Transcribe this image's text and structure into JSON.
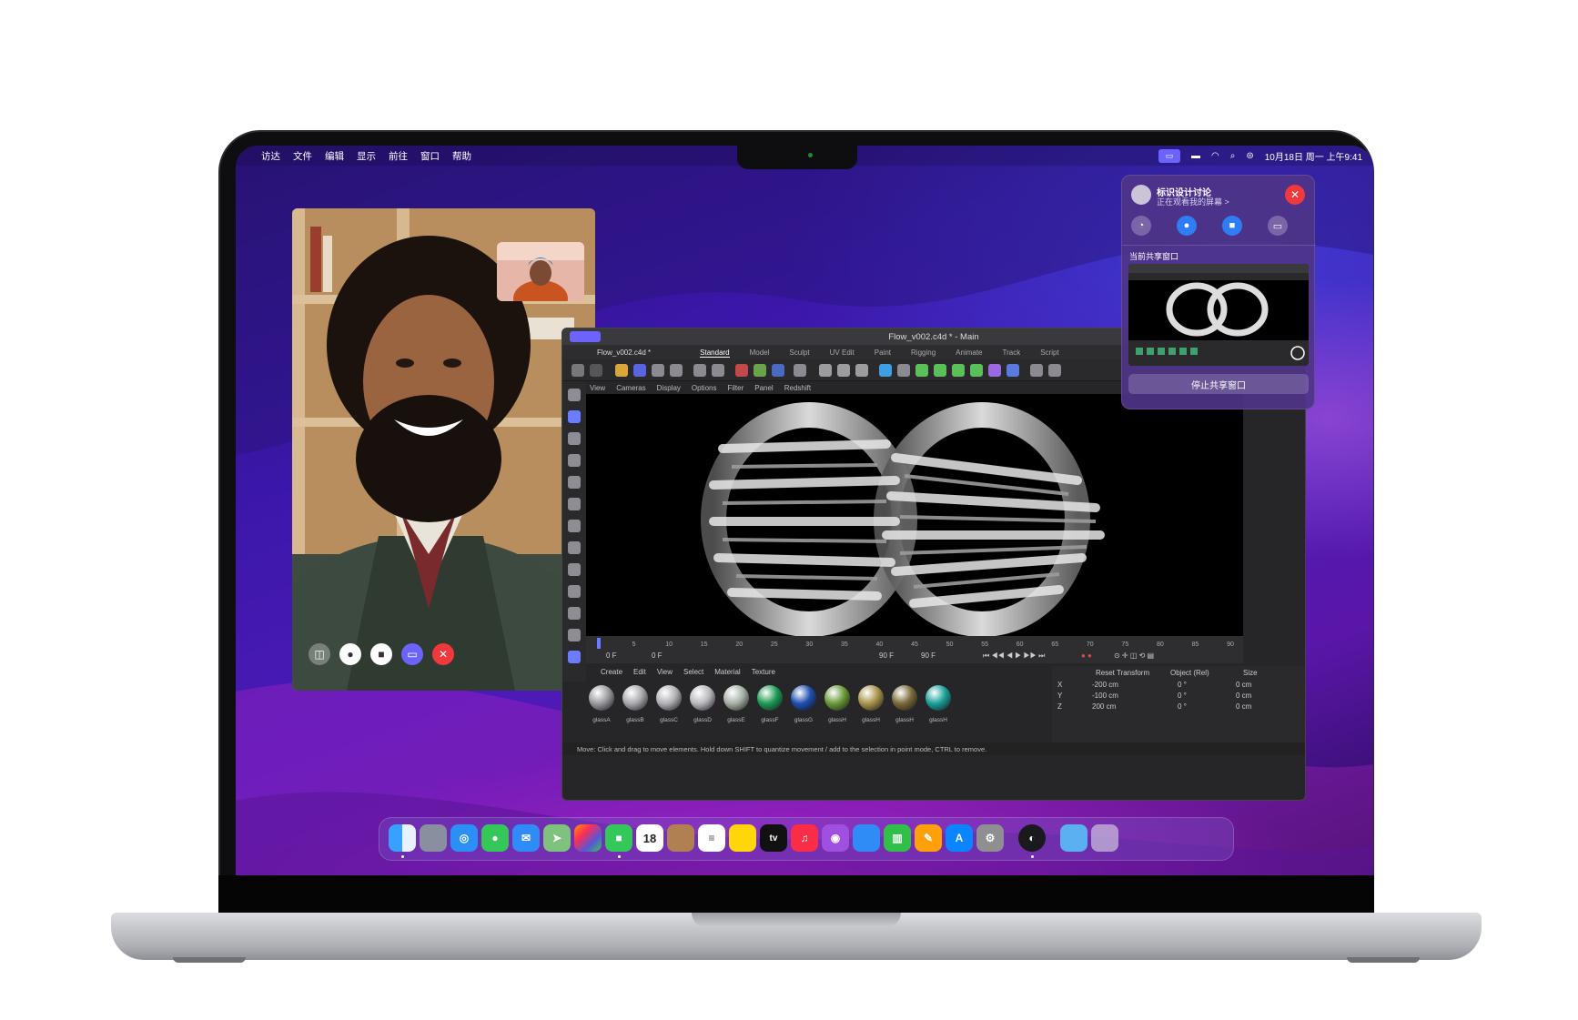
{
  "menubar": {
    "apple": "",
    "items": [
      "访达",
      "文件",
      "编辑",
      "显示",
      "前往",
      "窗口",
      "帮助"
    ],
    "clock": "10月18日 周一 上午9:41"
  },
  "shareplay": {
    "title": "标识设计讨论",
    "subtitle": "正在观看我的屏幕 >",
    "section_label": "当前共享窗口",
    "stop_button": "停止共享窗口"
  },
  "cinema4d": {
    "window_title": "Flow_v002.c4d * - Main",
    "file_tab": "Flow_v002.c4d *",
    "layouts": [
      "Standard",
      "Model",
      "Sculpt",
      "UV Edit",
      "Paint",
      "Rigging",
      "Animate",
      "Track",
      "Script"
    ],
    "active_layout": "Standard",
    "viewport_menu": [
      "View",
      "Cameras",
      "Display",
      "Options",
      "Filter",
      "Panel",
      "Redshift"
    ],
    "timeline_ticks": [
      "0",
      "5",
      "10",
      "15",
      "20",
      "25",
      "30",
      "35",
      "40",
      "45",
      "50",
      "55",
      "60",
      "65",
      "70",
      "75",
      "80",
      "85",
      "90"
    ],
    "timeline_fields": {
      "current": "0 F",
      "start": "0 F",
      "end": "90 F",
      "max": "90 F"
    },
    "material_menu": [
      "Create",
      "Edit",
      "View",
      "Select",
      "Material",
      "Texture"
    ],
    "materials": [
      "glassA",
      "glassB",
      "glassC",
      "glassD",
      "glassE",
      "glassF",
      "glassG",
      "glassH",
      "glassH",
      "glassH",
      "glassH"
    ],
    "coords": {
      "header": [
        "Reset Transform",
        "Object (Rel)",
        "Size"
      ],
      "rows": [
        {
          "axis": "X",
          "pos": "-200 cm",
          "rot": "0 °",
          "size": "0 cm"
        },
        {
          "axis": "Y",
          "pos": "-100 cm",
          "rot": "0 °",
          "size": "0 cm"
        },
        {
          "axis": "Z",
          "pos": "200 cm",
          "rot": "0 °",
          "size": "0 cm"
        }
      ]
    },
    "status": "Move: Click and drag to move elements. Hold down SHIFT to quantize movement / add to the selection in point mode, CTRL to remove."
  },
  "dock": {
    "calendar_day": "18",
    "tv_label": "tv"
  }
}
